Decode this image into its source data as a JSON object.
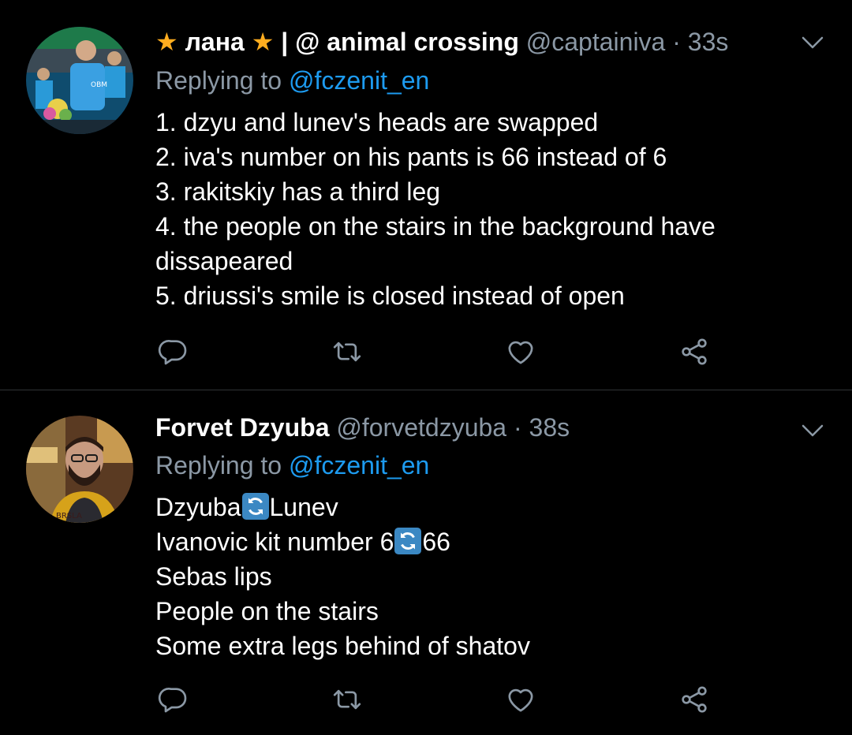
{
  "colors": {
    "background": "#000000",
    "primary_text": "#ffffff",
    "secondary_text": "#8b98a5",
    "link": "#1d9bf0",
    "star": "#ffad1f",
    "divider": "#2f3336"
  },
  "tweets": [
    {
      "display_name_prefix": "лана",
      "display_name_suffix": "| @ animal crossing",
      "name_emoji": "star-emoji",
      "handle": "@captainiva",
      "separator": "·",
      "time": "33s",
      "replying_prefix": "Replying to",
      "replying_to": "@fczenit_en",
      "lines": [
        "1. dzyu and lunev's heads are swapped",
        "2. iva's number on his pants is 66 instead of 6",
        "3. rakitskiy has a third leg",
        "4. the people on the stairs in the background have dissapeared",
        "5. driussi's smile is closed instead of open"
      ],
      "actions": [
        "reply-icon",
        "retweet-icon",
        "like-icon",
        "share-icon"
      ]
    },
    {
      "display_name": "Forvet Dzyuba",
      "handle": "@forvetdzyuba",
      "separator": "·",
      "time": "38s",
      "replying_prefix": "Replying to",
      "replying_to": "@fczenit_en",
      "line1_a": "Dzyuba",
      "line1_b": "Lunev",
      "line2_a": "Ivanovic kit number 6",
      "line2_b": "66",
      "line3": "Sebas lips",
      "line4": "People on the stairs",
      "line5": "Some extra legs behind of shatov",
      "inline_emoji": "arrows-counterclockwise-emoji",
      "actions": [
        "reply-icon",
        "retweet-icon",
        "like-icon",
        "share-icon"
      ]
    }
  ]
}
